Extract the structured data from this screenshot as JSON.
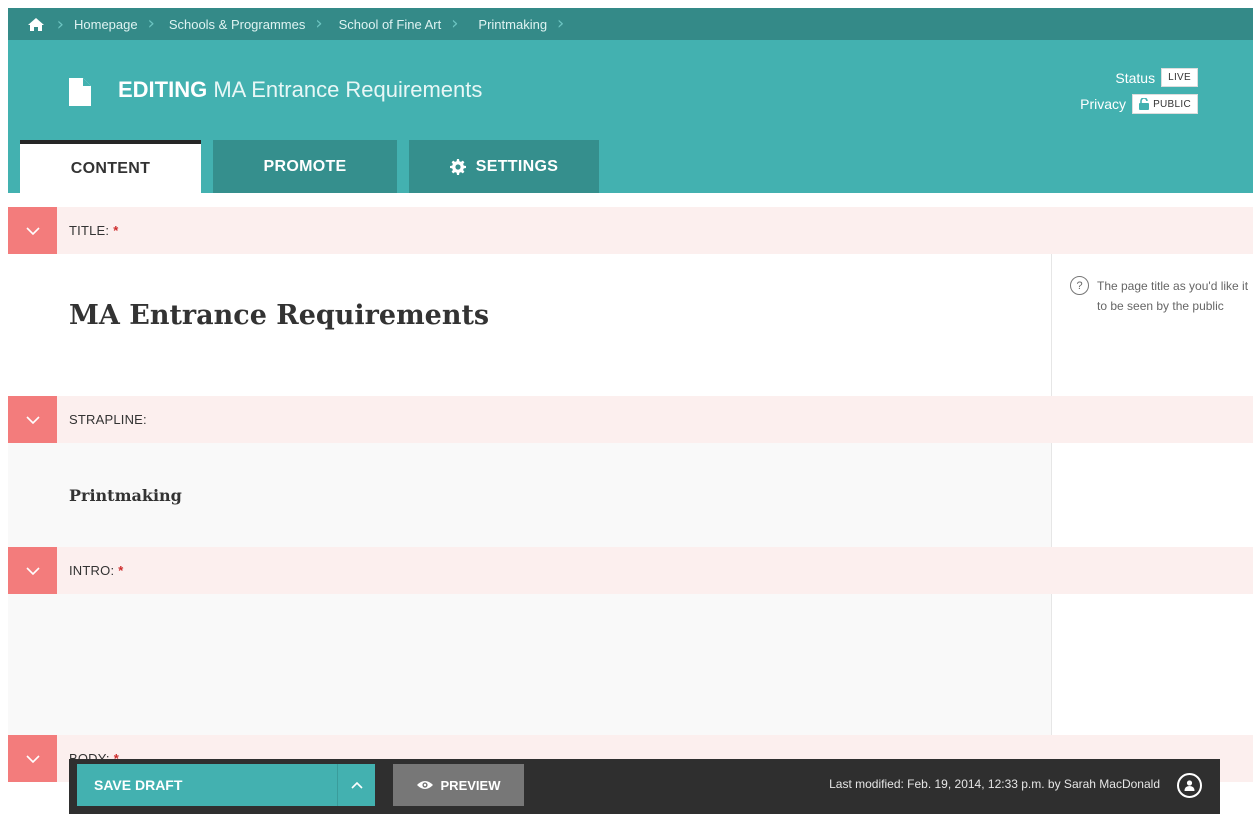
{
  "breadcrumb": {
    "items": [
      {
        "label": "Homepage"
      },
      {
        "label": "Schools & Programmes"
      },
      {
        "label": "School of Fine Art"
      },
      {
        "label": "Printmaking"
      }
    ]
  },
  "header": {
    "editing_prefix": "EDITING",
    "page_title": "MA Entrance Requirements",
    "status_label": "Status",
    "status_value": "LIVE",
    "privacy_label": "Privacy",
    "privacy_value": "PUBLIC"
  },
  "tabs": [
    {
      "label": "CONTENT",
      "active": true
    },
    {
      "label": "PROMOTE"
    },
    {
      "label": "SETTINGS",
      "icon": "gear-icon"
    }
  ],
  "fields": {
    "title": {
      "label": "TITLE:",
      "required": "*",
      "value": "MA Entrance Requirements",
      "help": "The page title as you'd like it to be seen by the public"
    },
    "strapline": {
      "label": "STRAPLINE:",
      "value": "Printmaking"
    },
    "intro": {
      "label": "INTRO:",
      "required": "*",
      "value": ""
    },
    "body": {
      "label": "BODY:",
      "required": "*"
    }
  },
  "footer": {
    "save_label": "SAVE DRAFT",
    "preview_label": "PREVIEW",
    "last_modified": "Last modified: Feb. 19, 2014, 12:33 p.m. by Sarah MacDonald"
  },
  "colors": {
    "teal": "#43b1b0",
    "dark_teal": "#348a88",
    "coral": "#f37c7c",
    "field_bg": "#fcefee",
    "footer": "#2f2f2f"
  }
}
